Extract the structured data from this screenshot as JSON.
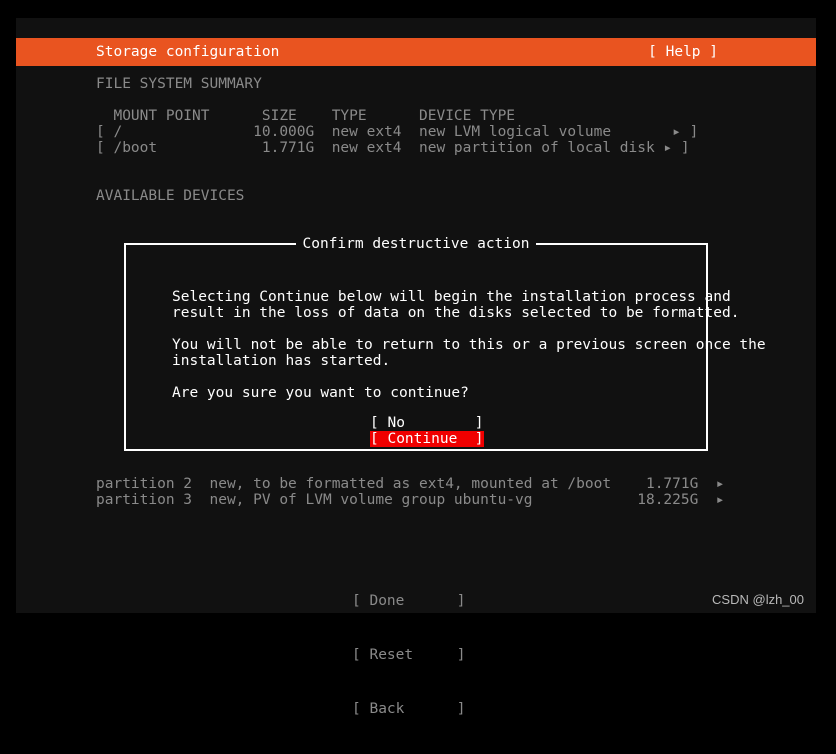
{
  "header": {
    "title": "Storage configuration",
    "help_label": "[ Help ]",
    "accent_color": "#e95420"
  },
  "sections": {
    "file_system_summary_label": "FILE SYSTEM SUMMARY",
    "available_devices_label": "AVAILABLE DEVICES"
  },
  "fs_table": {
    "columns": "  MOUNT POINT      SIZE    TYPE      DEVICE TYPE",
    "rows": [
      "[ /               10.000G  new ext4  new LVM logical volume       ▸ ]",
      "[ /boot            1.771G  new ext4  new partition of local disk ▸ ]"
    ]
  },
  "partitions": [
    "partition 2  new, to be formatted as ext4, mounted at /boot    1.771G  ▸",
    "partition 3  new, PV of LVM volume group ubuntu-vg            18.225G  ▸"
  ],
  "bottom_buttons": [
    "[ Done      ]",
    "[ Reset     ]",
    "[ Back      ]"
  ],
  "dialog": {
    "title": "Confirm destructive action",
    "paragraph1_line1": "Selecting Continue below will begin the installation process and",
    "paragraph1_line2": "result in the loss of data on the disks selected to be formatted.",
    "paragraph2_line1": "You will not be able to return to this or a previous screen once the",
    "paragraph2_line2": "installation has started.",
    "paragraph3": "Are you sure you want to continue?",
    "buttons": {
      "no_label": "[ No        ]",
      "continue_label": "[ Continue  ]",
      "selected": "continue",
      "selected_color": "#f00000"
    }
  },
  "watermark": "CSDN @lzh_00"
}
